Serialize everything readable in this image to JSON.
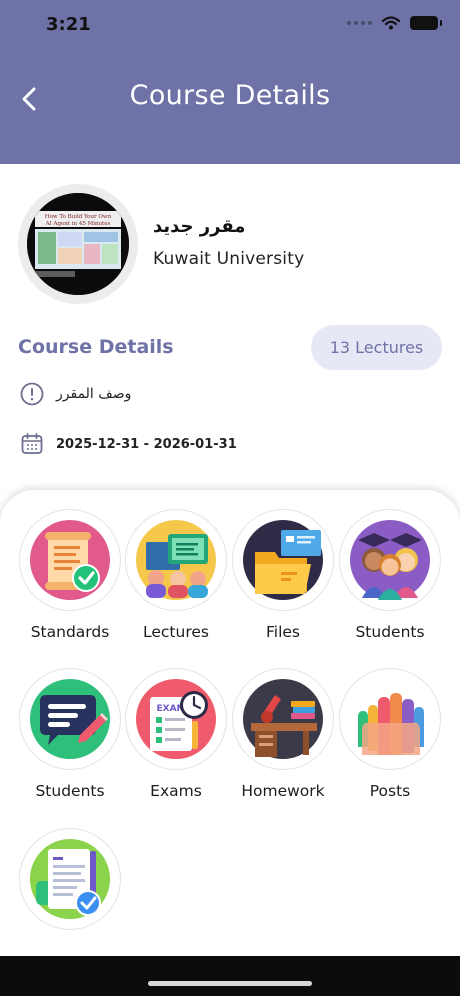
{
  "status_bar": {
    "time": "3:21"
  },
  "header": {
    "title": "Course Details",
    "back_icon": "chevron-left-icon"
  },
  "course": {
    "name": "مقرر جديد",
    "university": "Kuwait University",
    "thumbnail_text_line1": "How To Build Your Own",
    "thumbnail_text_line2": "AI Agent in 45 Minutes"
  },
  "details": {
    "title": "Course Details",
    "lectures_label": "13 Lectures",
    "description": "وصف المقرر",
    "date_range": "2025-12-31 - 2026-01-31"
  },
  "tiles": [
    {
      "label": "Standards",
      "icon": "standards-scroll-icon"
    },
    {
      "label": "Lectures",
      "icon": "lectures-classroom-icon"
    },
    {
      "label": "Files",
      "icon": "files-folder-icon"
    },
    {
      "label": "Students",
      "icon": "graduates-icon"
    },
    {
      "label": "Students",
      "icon": "chat-message-icon"
    },
    {
      "label": "Exams",
      "icon": "exam-clock-icon"
    },
    {
      "label": "Homework",
      "icon": "homework-desk-icon"
    },
    {
      "label": "Posts",
      "icon": "raised-hands-icon"
    },
    {
      "label": "",
      "icon": "checklist-clipboard-icon"
    }
  ],
  "colors": {
    "primary": "#6e72a6",
    "pill_bg": "#e7e8f5"
  }
}
